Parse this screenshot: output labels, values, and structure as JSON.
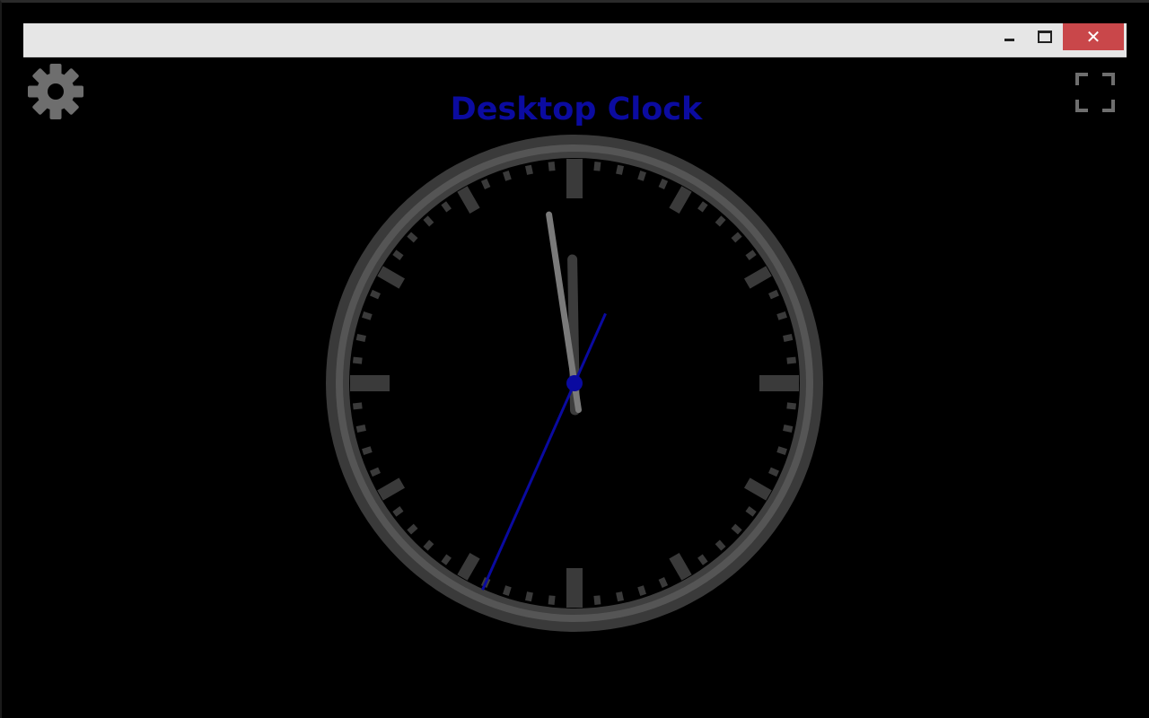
{
  "window": {
    "close_glyph": "✕",
    "minimize_icon": "minimize-icon",
    "maximize_icon": "maximize-icon"
  },
  "toolbar": {
    "settings_icon": "gear-icon",
    "fullscreen_icon": "fullscreen-icon"
  },
  "app": {
    "title": "Desktop Clock"
  },
  "clock": {
    "time": {
      "hours": 11,
      "minutes": 58,
      "seconds": 34
    },
    "colors": {
      "background": "#000000",
      "bezel_outer": "#3a3a3a",
      "bezel_inner": "#555555",
      "ticks": "#3a3a3a",
      "hour_hand": "#3c3c3c",
      "minute_hand": "#7a7a7a",
      "second_hand": "#0a0aa0",
      "title": "#0b0ba0",
      "close_button": "#c9474a"
    }
  }
}
